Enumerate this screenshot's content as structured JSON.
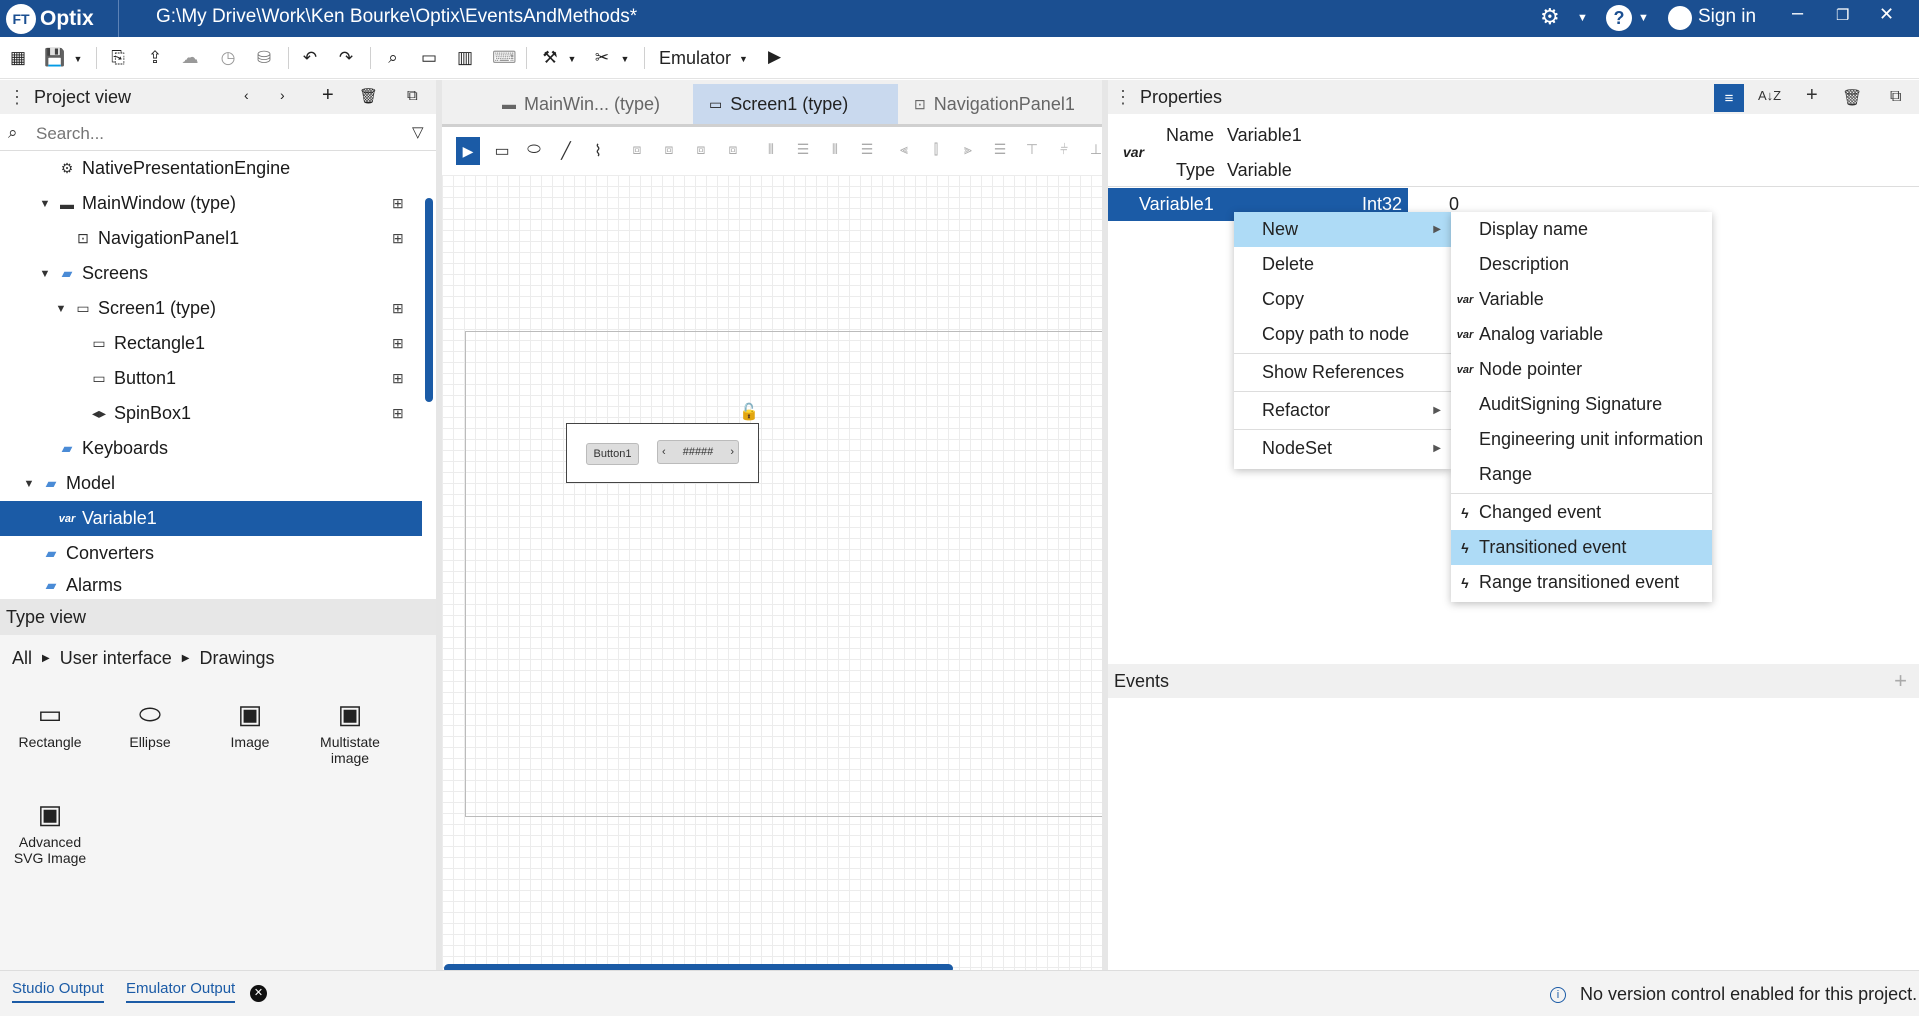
{
  "app": {
    "logo_badge": "FT",
    "logo_name": "Optix",
    "path": "G:\\My Drive\\Work\\Ken Bourke\\Optix\\EventsAndMethods*",
    "sign_in": "Sign in"
  },
  "toolbar": {
    "emulator_label": "Emulator"
  },
  "project": {
    "title": "Project view",
    "search_placeholder": "Search...",
    "tree": [
      {
        "label": "NativePresentationEngine"
      },
      {
        "label": "MainWindow (type)"
      },
      {
        "label": "NavigationPanel1"
      },
      {
        "label": "Screens"
      },
      {
        "label": "Screen1 (type)"
      },
      {
        "label": "Rectangle1"
      },
      {
        "label": "Button1"
      },
      {
        "label": "SpinBox1"
      },
      {
        "label": "Keyboards"
      },
      {
        "label": "Model"
      },
      {
        "label": "Variable1",
        "icon_text": "var"
      },
      {
        "label": "Converters"
      },
      {
        "label": "Alarms"
      }
    ]
  },
  "typeview": {
    "title": "Type view",
    "breadcrumb": [
      "All",
      "User interface",
      "Drawings"
    ],
    "items": [
      "Rectangle",
      "Ellipse",
      "Image",
      "Multistate image",
      "Advanced SVG Image"
    ]
  },
  "editor": {
    "tabs": [
      "MainWin... (type)",
      "Screen1 (type)",
      "NavigationPanel1"
    ],
    "button_text": "Button1",
    "spin_text": "#####"
  },
  "properties": {
    "title": "Properties",
    "icon_text": "var",
    "name_label": "Name",
    "name_value": "Variable1",
    "type_label": "Type",
    "type_value": "Variable",
    "var_name": "Variable1",
    "var_type": "Int32",
    "var_value": "0",
    "events_title": "Events"
  },
  "context_menu": {
    "items": [
      "New",
      "Delete",
      "Copy",
      "Copy path to node",
      "Show References",
      "Refactor",
      "NodeSet"
    ]
  },
  "submenu": {
    "items": [
      {
        "label": "Display name",
        "icon": ""
      },
      {
        "label": "Description",
        "icon": ""
      },
      {
        "label": "Variable",
        "icon": "var"
      },
      {
        "label": "Analog variable",
        "icon": "var"
      },
      {
        "label": "Node pointer",
        "icon": "var"
      },
      {
        "label": "AuditSigning Signature",
        "icon": ""
      },
      {
        "label": "Engineering unit information",
        "icon": ""
      },
      {
        "label": "Range",
        "icon": ""
      },
      {
        "label": "Changed event",
        "icon": "event-icon"
      },
      {
        "label": "Transitioned event",
        "icon": "event-icon"
      },
      {
        "label": "Range transitioned event",
        "icon": "event-icon"
      }
    ]
  },
  "status": {
    "tab1": "Studio Output",
    "tab2": "Emulator Output",
    "message": "No version control enabled for this project."
  },
  "colors": {
    "brand": "#1b4f91",
    "selection": "#1b5ba6",
    "menu_highlight": "#aedbf6"
  }
}
